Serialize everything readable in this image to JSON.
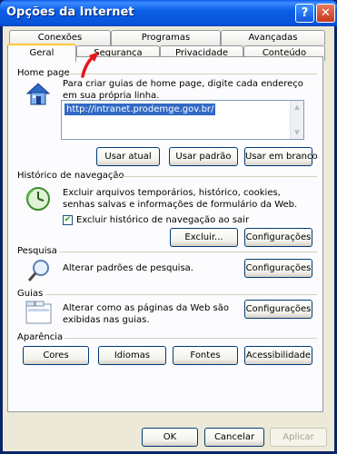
{
  "window": {
    "title": "Opções da Internet",
    "help_glyph": "?",
    "close_glyph": "✕"
  },
  "tabs": {
    "row1": [
      "Conexões",
      "Programas",
      "Avançadas"
    ],
    "row2": [
      "Geral",
      "Segurança",
      "Privacidade",
      "Conteúdo"
    ],
    "active": "Geral"
  },
  "home_page": {
    "section_label": "Home page",
    "description": "Para criar guias de home page, digite cada endereço em sua própria linha.",
    "url": "http://intranet.prodemge.gov.br/",
    "buttons": {
      "use_current": "Usar atual",
      "use_default": "Usar padrão",
      "use_blank": "Usar em branco"
    }
  },
  "history": {
    "section_label": "Histórico de navegação",
    "description": "Excluir arquivos temporários, histórico, cookies, senhas salvas e informações de formulário da Web.",
    "checkbox_label": "Excluir histórico de navegação ao sair",
    "checkbox_checked": true,
    "buttons": {
      "delete": "Excluir...",
      "settings": "Configurações"
    }
  },
  "search": {
    "section_label": "Pesquisa",
    "description": "Alterar padrões de pesquisa.",
    "settings_button": "Configurações"
  },
  "tabs_section": {
    "section_label": "Guias",
    "description": "Alterar como as páginas da Web são exibidas nas guias.",
    "settings_button": "Configurações"
  },
  "appearance": {
    "section_label": "Aparência",
    "buttons": {
      "colors": "Cores",
      "languages": "Idiomas",
      "fonts": "Fontes",
      "accessibility": "Acessibilidade"
    }
  },
  "footer": {
    "ok": "OK",
    "cancel": "Cancelar",
    "apply": "Aplicar"
  },
  "colors": {
    "titlebar": "#0a5fe5",
    "dialog_bg": "#ece9d8",
    "selection": "#316ac5",
    "annotation_arrow": "#e8141b"
  }
}
